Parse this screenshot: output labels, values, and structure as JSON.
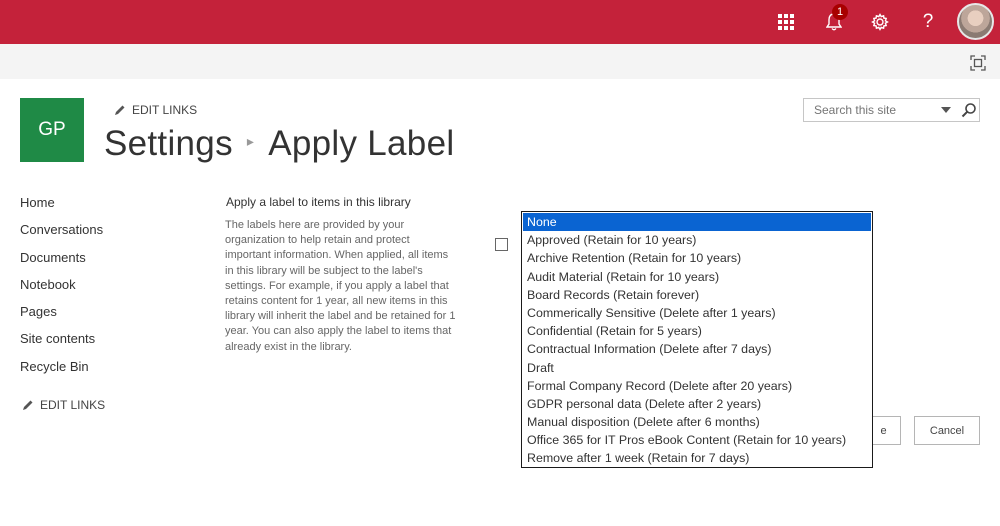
{
  "suite_bar": {
    "notification_count": "1",
    "help_label": "?",
    "icons": [
      "app-launcher-icon",
      "bell-icon",
      "gear-icon",
      "help-icon"
    ],
    "accent_color": "#c4223a"
  },
  "site": {
    "logo_text": "GP",
    "logo_color": "#1f8a46",
    "edit_links": "EDIT LINKS",
    "breadcrumb_parent": "Settings",
    "breadcrumb_separator": "▸",
    "page_title": "Apply Label"
  },
  "search": {
    "placeholder": "Search this site"
  },
  "left_nav": {
    "items": [
      "Home",
      "Conversations",
      "Documents",
      "Notebook",
      "Pages",
      "Site contents",
      "Recycle Bin"
    ],
    "edit_links": "EDIT LINKS"
  },
  "section": {
    "title": "Apply a label to items in this library",
    "description": "The labels here are provided by your organization to help retain and protect important information. When applied, all items in this library will be subject to the label's settings. For example, if you apply a label that retains content for 1 year, all new items in this library will inherit the label and be retained for 1 year. You can also apply the label to items that already exist in the library."
  },
  "label_list": {
    "selected_index": 0,
    "options": [
      "None",
      "Approved (Retain for 10 years)",
      "Archive Retention (Retain for 10 years)",
      "Audit Material (Retain for 10 years)",
      "Board Records (Retain forever)",
      "Commerically Sensitive (Delete after 1 years)",
      "Confidential (Retain for 5 years)",
      "Contractual Information (Delete after 7 days)",
      "Draft",
      "Formal Company Record (Delete after 20 years)",
      "GDPR personal data (Delete after 2 years)",
      "Manual disposition (Delete after 6 months)",
      "Office 365 for IT Pros eBook Content (Retain for 10 years)",
      "Remove after 1 week (Retain for 7 days)"
    ]
  },
  "buttons": {
    "save_partial": "e",
    "cancel": "Cancel"
  }
}
